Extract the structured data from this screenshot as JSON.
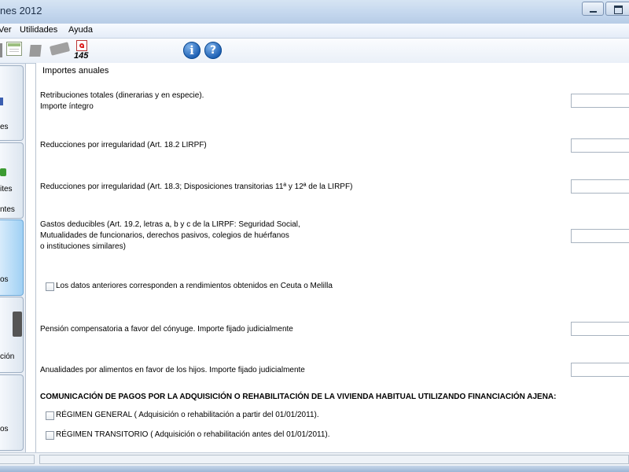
{
  "window": {
    "title": "nes 2012"
  },
  "menu": {
    "items": [
      "Ver",
      "Utilidades",
      "Ayuda"
    ]
  },
  "toolbar": {
    "icons": [
      "document-icon",
      "page-icon",
      "book-icon",
      "pdf-145-icon",
      "info-icon",
      "help-icon"
    ],
    "pdf_number": "145",
    "info_glyph": "i",
    "help_glyph": "?"
  },
  "sidebar": {
    "items": [
      {
        "label": "es"
      },
      {
        "label": "ites",
        "label2": "ntes"
      },
      {
        "label": "os",
        "active": true
      },
      {
        "label": "ción"
      },
      {
        "label": "os"
      }
    ]
  },
  "form": {
    "group_title": "Importes anuales",
    "fields": [
      {
        "label": "Retribuciones totales (dinerarias y en especie).\nImporte íntegro",
        "value": ""
      },
      {
        "label": "Reducciones por irregularidad (Art. 18.2 LIRPF)",
        "value": ""
      },
      {
        "label": "Reducciones por irregularidad (Art. 18.3; Disposiciones transitorias 11ª y 12ª de la LIRPF)",
        "value": ""
      },
      {
        "label": "Gastos deducibles (Art. 19.2, letras a, b y c de la LIRPF: Seguridad Social,\nMutualidades de funcionarios, derechos pasivos, colegios de huérfanos\no instituciones similares)",
        "value": ""
      }
    ],
    "ceuta_checkbox": {
      "label": "Los datos anteriores corresponden a rendimientos obtenidos en Ceuta o Melilla",
      "checked": false
    },
    "fields2": [
      {
        "label": "Pensión compensatoria a favor del cónyuge. Importe fijado judicialmente",
        "value": ""
      },
      {
        "label": "Anualidades por alimentos en favor de los hijos. Importe fijado judicialmente",
        "value": ""
      }
    ],
    "section_heading": "COMUNICACIÓN DE PAGOS POR LA ADQUISICIÓN O REHABILITACIÓN DE LA VIVIENDA HABITUAL UTILIZANDO FINANCIACIÓN AJENA:",
    "regimen_general": {
      "label": "RÉGIMEN GENERAL ( Adquisición o rehabilitación a partir del 01/01/2011).",
      "checked": false
    },
    "regimen_transitorio": {
      "label": "RÉGIMEN TRANSITORIO ( Adquisición o rehabilitación antes del 01/01/2011).",
      "checked": false
    }
  },
  "colors": {
    "active_nav": "#9fd0f4",
    "title_bar": "#c4d7ee",
    "accent_icon": "#1c5fb3"
  }
}
